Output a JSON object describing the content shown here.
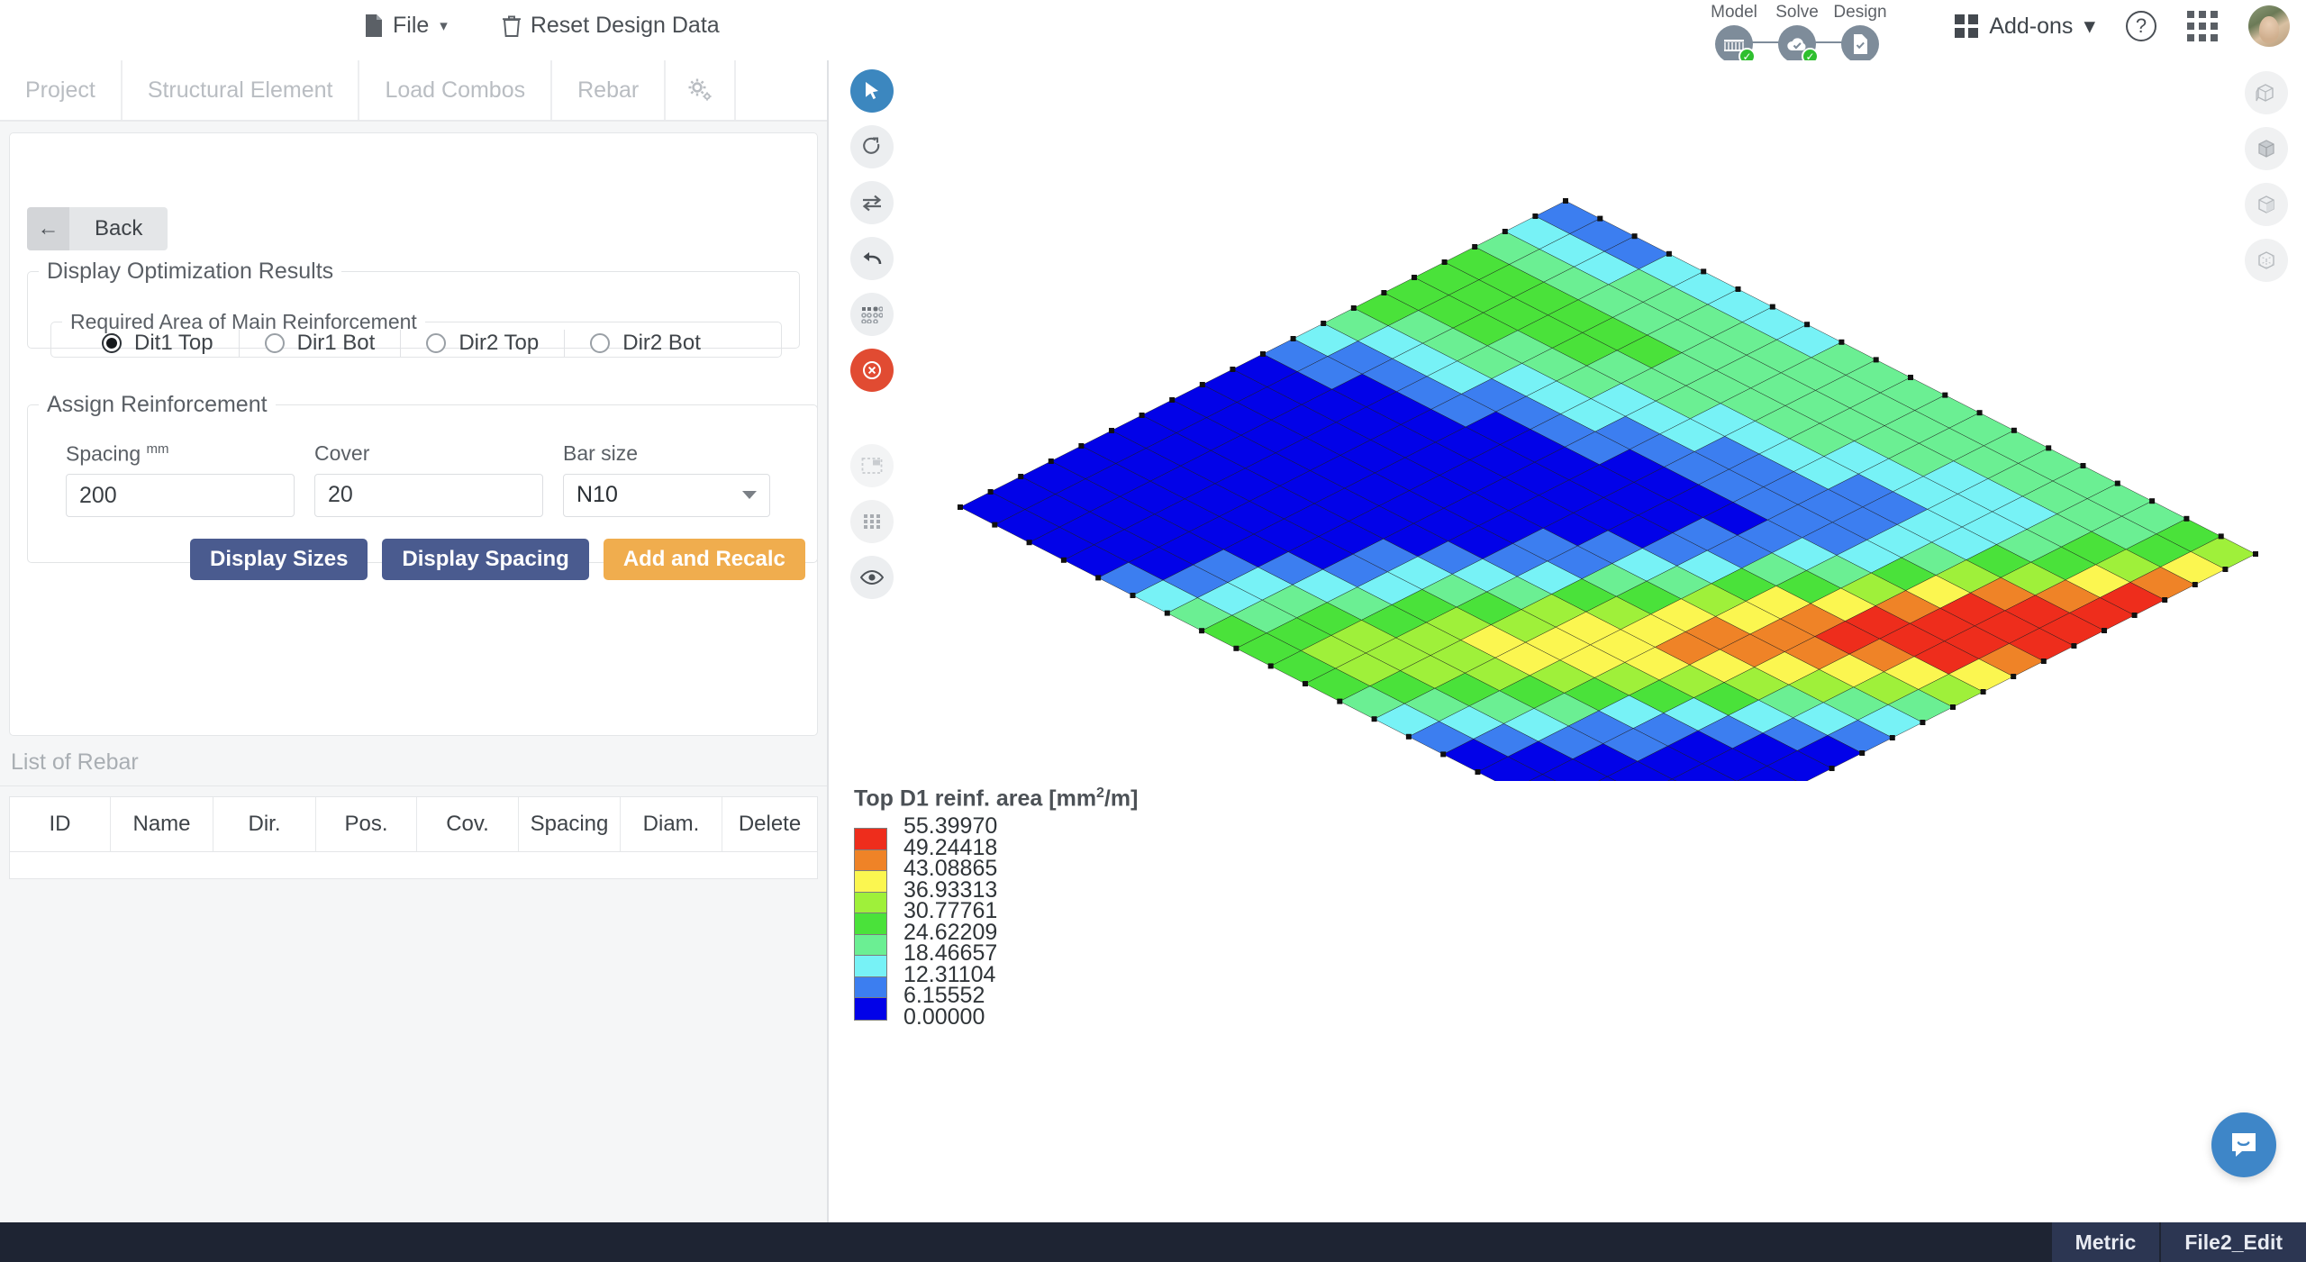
{
  "topbar": {
    "menu": [
      {
        "label": "File",
        "icon": "file-icon",
        "has_caret": true
      },
      {
        "label": "Reset Design Data",
        "icon": "trash-icon",
        "has_caret": false
      }
    ],
    "workflow": [
      {
        "label": "Model",
        "icon": "bridge-icon",
        "complete": true
      },
      {
        "label": "Solve",
        "icon": "cloud-check-icon",
        "complete": true
      },
      {
        "label": "Design",
        "icon": "document-check-icon",
        "complete": false
      }
    ],
    "addons_label": "Add-ons",
    "help_glyph": "?",
    "apps_icon": "apps-grid-icon",
    "avatar_icon": "user-avatar"
  },
  "tabs": [
    {
      "label": "Project",
      "name": "tab-project"
    },
    {
      "label": "Structural Element",
      "name": "tab-structural-element"
    },
    {
      "label": "Load Combos",
      "name": "tab-load-combos"
    },
    {
      "label": "Rebar",
      "name": "tab-rebar"
    },
    {
      "label": "",
      "name": "tab-settings",
      "icon": "gears-icon"
    }
  ],
  "panel": {
    "back_label": "Back",
    "display_group_title": "Display Optimization Results",
    "required_group_title": "Required Area of Main Reinforcement",
    "radios": [
      {
        "label": "Dit1 Top",
        "selected": true
      },
      {
        "label": "Dir1 Bot",
        "selected": false
      },
      {
        "label": "Dir2 Top",
        "selected": false
      },
      {
        "label": "Dir2 Bot",
        "selected": false
      }
    ],
    "assign_group_title": "Assign Reinforcement",
    "fields": {
      "spacing_label": "Spacing",
      "spacing_unit": "mm",
      "spacing_value": "200",
      "cover_label": "Cover",
      "cover_value": "20",
      "barsize_label": "Bar size",
      "barsize_value": "N10"
    },
    "buttons": [
      {
        "label": "Display Sizes",
        "style": "primary"
      },
      {
        "label": "Display Spacing",
        "style": "primary"
      },
      {
        "label": "Add and Recalc",
        "style": "warn"
      }
    ]
  },
  "rebar_list": {
    "title": "List of Rebar",
    "columns": [
      "ID",
      "Name",
      "Dir.",
      "Pos.",
      "Cov.",
      "Spacing",
      "Diam.",
      "Delete"
    ],
    "rows": []
  },
  "viewport_tools": {
    "left": [
      {
        "name": "select-cursor-icon",
        "state": "active"
      },
      {
        "name": "rotate-icon",
        "state": "normal"
      },
      {
        "name": "swap-arrows-icon",
        "state": "normal"
      },
      {
        "name": "undo-arrow-icon",
        "state": "normal"
      },
      {
        "name": "node-select-icon",
        "state": "normal"
      },
      {
        "name": "clear-selection-icon",
        "state": "danger"
      },
      {
        "name": "marquee-select-icon",
        "state": "faint"
      },
      {
        "name": "grid-icon",
        "state": "ghost"
      },
      {
        "name": "eye-visibility-icon",
        "state": "normal"
      }
    ],
    "right": [
      {
        "name": "view-front-icon"
      },
      {
        "name": "view-iso-icon"
      },
      {
        "name": "view-side-icon"
      },
      {
        "name": "view-wireframe-icon"
      }
    ]
  },
  "chart_data": {
    "type": "heatmap",
    "title": "Top D1 reinf. area [mm2/m]",
    "title_base": "Top D1 reinf. area [mm",
    "title_sup": "2",
    "title_tail": "/m]",
    "unit": "mm2/m",
    "legend_position": "bottom-left",
    "colorbar": {
      "labels": [
        "55.39970",
        "49.24418",
        "43.08865",
        "36.93313",
        "30.77761",
        "24.62209",
        "18.46657",
        "12.31104",
        "6.15552",
        "0.00000"
      ],
      "values": [
        55.3997,
        49.24418,
        43.08865,
        36.93313,
        30.77761,
        24.62209,
        18.46657,
        12.31104,
        6.15552,
        0.0
      ],
      "colors": [
        "#ee2d1c",
        "#ef8327",
        "#fbf650",
        "#9ff03a",
        "#4ae23a",
        "#6bef93",
        "#77f2f6",
        "#3c7ef0",
        "#0202e8"
      ],
      "band_count": 9
    },
    "vmin": 0.0,
    "vmax": 55.3997,
    "grid_cols": 20,
    "grid_rows": 20,
    "description": "Isometric slab finite-element mesh colored by required top D1 reinforcement area; a diagonal high-demand band runs across the slab with peak red values near 55 mm2/m, surrounded by blue low-demand regions near 0."
  },
  "status": {
    "units": "Metric",
    "file": "File2_Edit"
  },
  "chat": {
    "icon": "chat-bubble-icon"
  },
  "colors": {
    "accent_blue": "#3c87bf",
    "primary_button": "#4a5b8f",
    "warn_button": "#f0ad4e",
    "danger": "#e14b32",
    "status_bg": "#1e2433",
    "status_cell": "#2c3652"
  }
}
